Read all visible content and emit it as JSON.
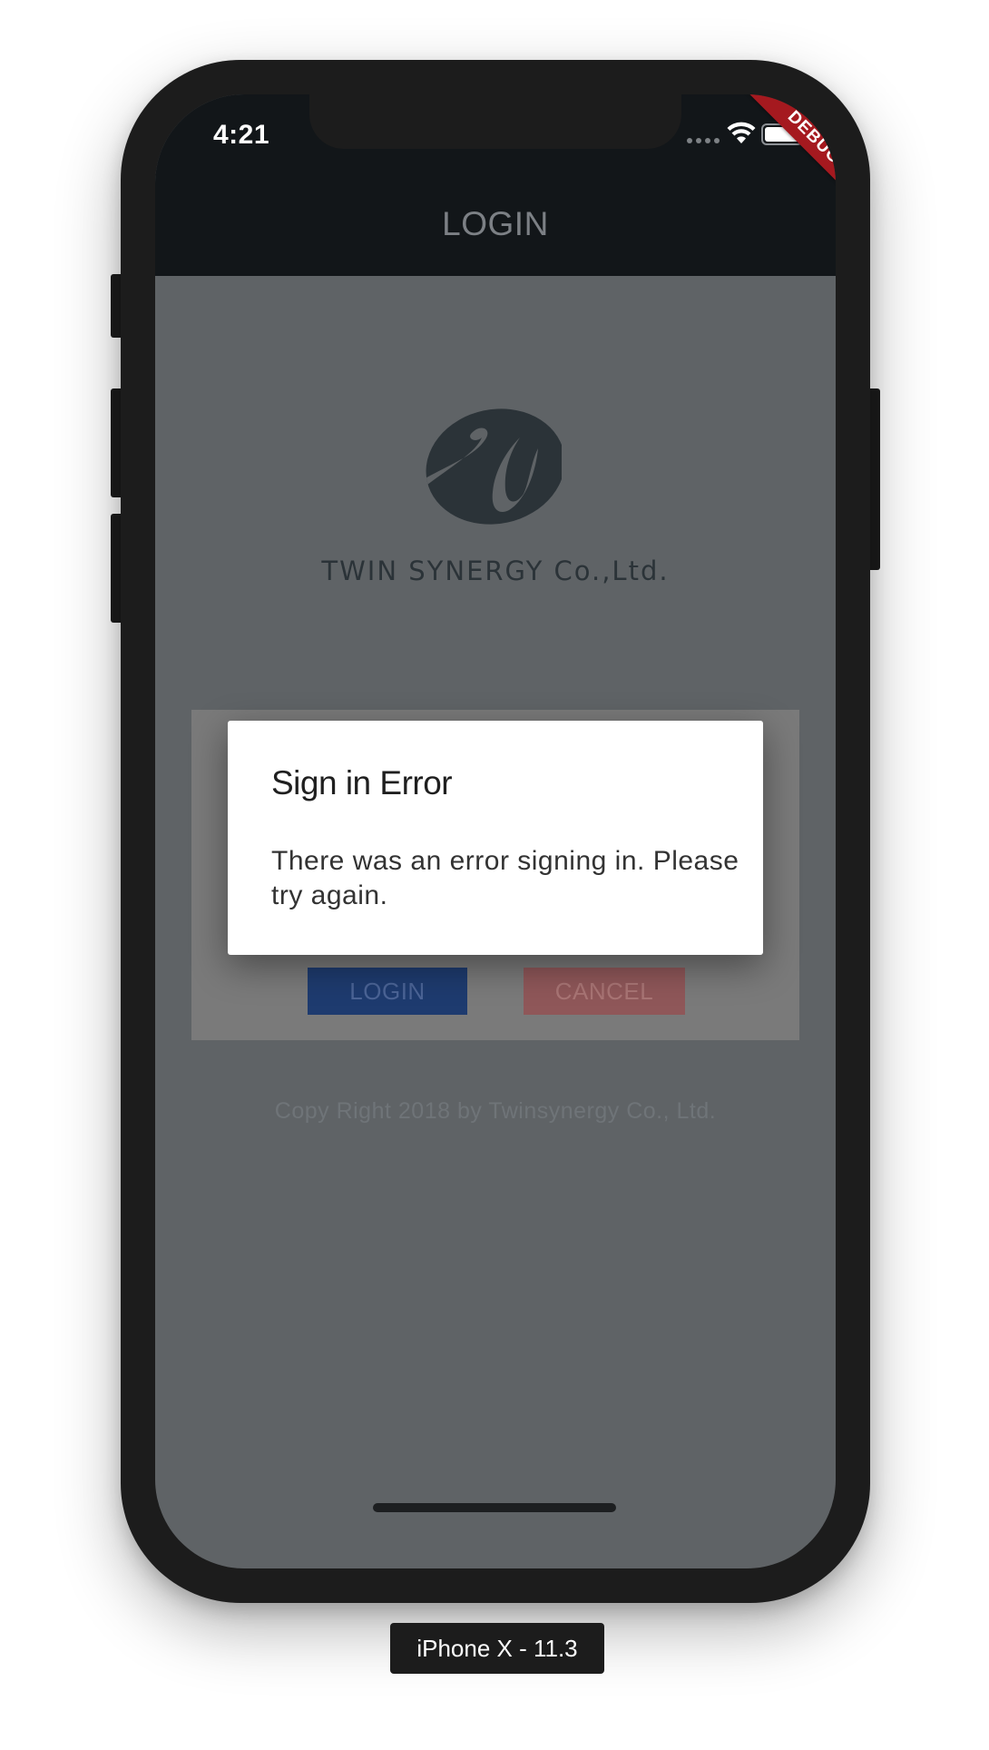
{
  "status_bar": {
    "time": "4:21",
    "debug_banner": "DEBUG"
  },
  "app_bar": {
    "title": "LOGIN"
  },
  "logo": {
    "company_name": "TWIN SYNERGY Co.,Ltd."
  },
  "login_form": {
    "login_button": "LOGIN",
    "cancel_button": "CANCEL"
  },
  "footer": {
    "copyright": "Copy Right 2018 by Twinsynergy Co., Ltd."
  },
  "dialog": {
    "title": "Sign in Error",
    "message": "There was an error signing in. Please try again."
  },
  "device_label": "iPhone X - 11.3",
  "colors": {
    "app_bar": "#121619",
    "scrim": "#5f6366",
    "login_button": "#1e3b6f",
    "cancel_button": "#8f5759",
    "debug_ribbon": "#a5191f"
  },
  "icons": [
    "signal-dots-icon",
    "wifi-icon",
    "battery-icon",
    "company-logo-icon"
  ]
}
